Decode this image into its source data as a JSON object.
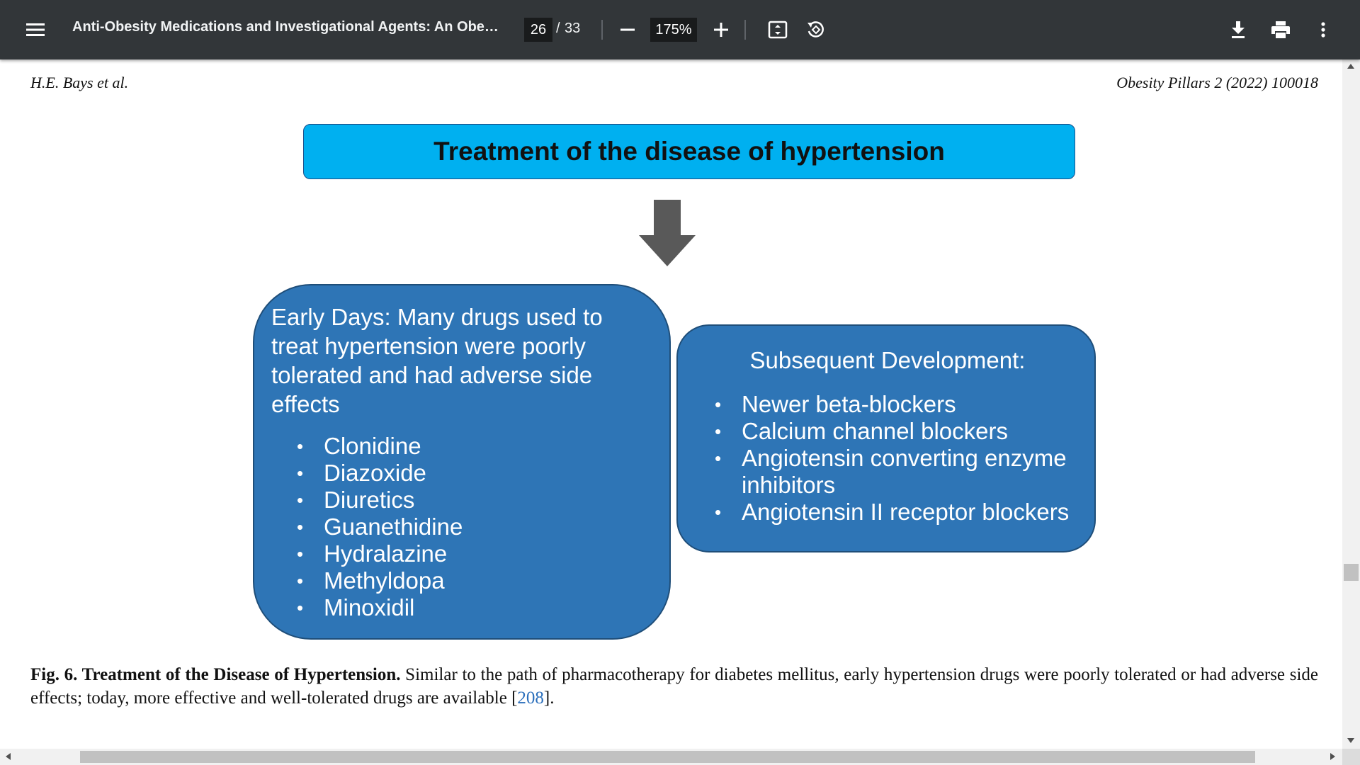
{
  "toolbar": {
    "icons": {
      "menu": "hamburger-menu-icon",
      "zoom_out": "minus-icon",
      "zoom_in": "plus-icon",
      "fit": "fit-to-page-icon",
      "rotate": "rotate-counterclockwise-icon",
      "download": "download-icon",
      "print": "print-icon",
      "more": "more-vertical-icon"
    },
    "document_title": "Anti-Obesity Medications and Investigational Agents: An Obesit...",
    "current_page": "26",
    "page_separator": "/",
    "total_pages": "33",
    "zoom": "175%"
  },
  "page": {
    "header_left": "H.E. Bays et al.",
    "header_right": "Obesity Pillars 2 (2022) 100018",
    "figure": {
      "title": "Treatment of the disease of hypertension",
      "left_box": {
        "intro": "Early Days:  Many drugs used to treat hypertension were poorly tolerated and had adverse side effects",
        "items": [
          "Clonidine",
          "Diazoxide",
          "Diuretics",
          "Guanethidine",
          "Hydralazine",
          "Methyldopa",
          "Minoxidil"
        ]
      },
      "right_box": {
        "heading": "Subsequent Development:",
        "items": [
          "Newer beta-blockers",
          "Calcium channel blockers",
          "Angiotensin converting enzyme inhibitors",
          "Angiotensin II receptor blockers"
        ]
      },
      "bullet": "•"
    },
    "caption": {
      "label": "Fig. 6.  Treatment of the Disease of Hypertension.",
      "text": " Similar to the path of pharmacotherapy for diabetes mellitus, early hypertension drugs were poorly tolerated or had adverse side effects; today, more effective and well-tolerated drugs are available [",
      "ref": "208",
      "end": "]."
    }
  },
  "colors": {
    "toolbar_bg": "#323639",
    "title_box": "#00b0f0",
    "content_box": "#2e75b6",
    "arrow": "#595959",
    "link": "#2a6ebb"
  }
}
